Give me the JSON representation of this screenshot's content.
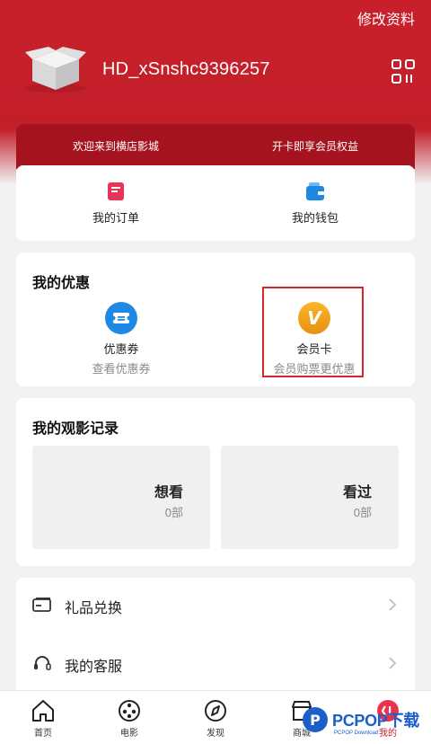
{
  "header": {
    "edit_profile": "修改资料",
    "username": "HD_xSnshc9396257"
  },
  "banner": {
    "left": "欢迎来到横店影城",
    "right": "开卡即享会员权益"
  },
  "quick_actions": [
    {
      "label": "我的订单",
      "icon": "order-icon"
    },
    {
      "label": "我的钱包",
      "icon": "wallet-icon"
    }
  ],
  "coupons": {
    "title": "我的优惠",
    "items": [
      {
        "label": "优惠券",
        "sub": "查看优惠券",
        "icon": "ticket-icon"
      },
      {
        "label": "会员卡",
        "sub": "会员购票更优惠",
        "icon": "vip-card-icon"
      }
    ]
  },
  "records": {
    "title": "我的观影记录",
    "items": [
      {
        "label": "想看",
        "count": "0部"
      },
      {
        "label": "看过",
        "count": "0部"
      }
    ]
  },
  "menu": [
    {
      "label": "礼品兑换",
      "icon": "gift-card-icon"
    },
    {
      "label": "我的客服",
      "icon": "headset-icon"
    }
  ],
  "tabs": [
    {
      "label": "首页",
      "icon": "home-icon"
    },
    {
      "label": "电影",
      "icon": "film-reel-icon"
    },
    {
      "label": "发现",
      "icon": "compass-icon"
    },
    {
      "label": "商城",
      "icon": "store-icon"
    },
    {
      "label": "我的",
      "icon": "profile-icon"
    }
  ],
  "watermark": {
    "brand": "PCPOP下载",
    "sub": "PCPOP Download"
  },
  "colors": {
    "brand_red": "#c8202b",
    "banner_red": "#a5141e",
    "accent_blue": "#1e88e5",
    "accent_gold": "#f0a020"
  }
}
